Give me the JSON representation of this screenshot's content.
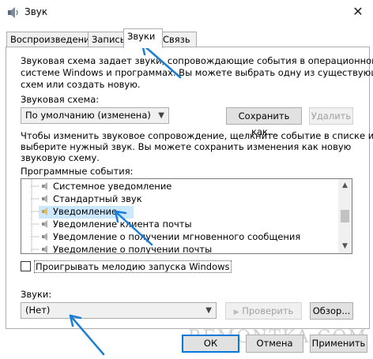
{
  "window": {
    "title": "Звук",
    "close_glyph": "✕"
  },
  "tabs": [
    {
      "label": "Воспроизведение"
    },
    {
      "label": "Запись"
    },
    {
      "label": "Звуки"
    },
    {
      "label": "Связь"
    }
  ],
  "description": {
    "line1": "Звуковая схема задает звуки, сопровождающие события в операционной",
    "line2": "системе Windows и программах. Вы можете выбрать одну из существующих",
    "line3": "схем или создать новую."
  },
  "scheme": {
    "label": "Звуковая схема:",
    "value": "По умолчанию (изменена)",
    "save_label": "Сохранить как...",
    "delete_label": "Удалить"
  },
  "instruction": {
    "line1": "Чтобы изменить звуковое сопровождение, щелкните событие в списке и",
    "line2": "выберите нужный звук. Вы можете сохранить изменения как новую",
    "line3": "звуковую схему."
  },
  "events": {
    "label": "Программные события:",
    "items": [
      {
        "label": "Системное уведомление"
      },
      {
        "label": "Стандартный звук"
      },
      {
        "label": "Уведомление"
      },
      {
        "label": "Уведомление клиента почты"
      },
      {
        "label": "Уведомление о получении мгновенного сообщения"
      },
      {
        "label": "Уведомление о получении почты"
      }
    ]
  },
  "startup_checkbox": {
    "label": "Проигрывать мелодию запуска Windows",
    "checked": false
  },
  "sounds": {
    "label": "Звуки:",
    "value": "(Нет)",
    "test_label": "Проверить",
    "browse_label": "Обзор..."
  },
  "footer": {
    "ok_label": "ОК",
    "cancel_label": "Отмена",
    "apply_label": "Применить"
  },
  "watermark": "REMONTKA.COM",
  "colors": {
    "accent": "#0078d7",
    "annotation_arrow": "#1a7fd4",
    "selection": "#cce8ff"
  }
}
